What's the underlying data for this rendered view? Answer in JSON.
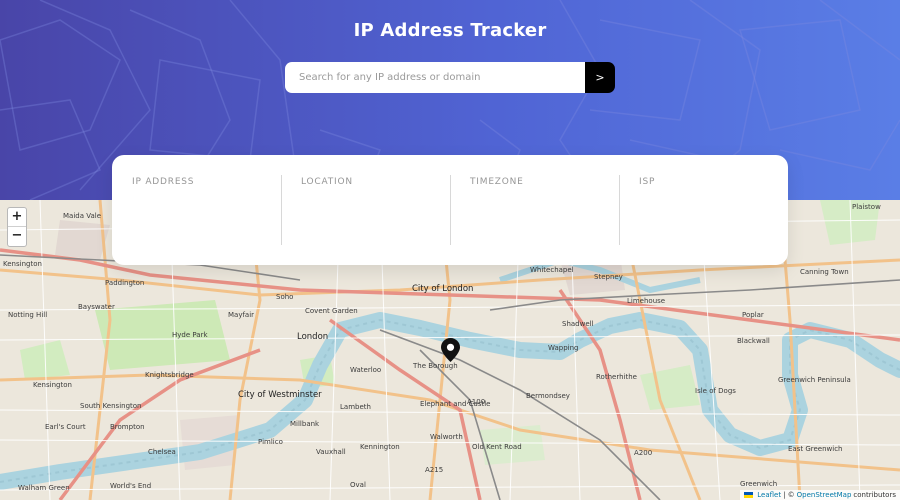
{
  "app": {
    "title": "IP Address Tracker"
  },
  "search": {
    "placeholder": "Search for any IP address or domain",
    "value": "",
    "submit_label": ">"
  },
  "info": [
    {
      "label": "IP ADDRESS",
      "value": ""
    },
    {
      "label": "LOCATION",
      "value": ""
    },
    {
      "label": "TIMEZONE",
      "value": ""
    },
    {
      "label": "ISP",
      "value": ""
    }
  ],
  "map": {
    "zoom_in": "+",
    "zoom_out": "−",
    "attribution": {
      "leaflet": "Leaflet",
      "separator": "| ©",
      "osm": "OpenStreetMap",
      "suffix": "contributors"
    },
    "labels": {
      "maida_vale": "Maida Vale",
      "kensington_top": "Kensington",
      "paddington": "Paddington",
      "bayswater": "Bayswater",
      "notting_hill": "Notting Hill",
      "kensington": "Kensington",
      "south_kensington": "South Kensington",
      "earls_court": "Earl's Court",
      "brompton": "Brompton",
      "chelsea": "Chelsea",
      "walham_green": "Walham Green",
      "worlds_end": "World's End",
      "hyde_park": "Hyde Park",
      "knightsbridge": "Knightsbridge",
      "mayfair": "Mayfair",
      "soho": "Soho",
      "covent_garden": "Covent Garden",
      "london": "London",
      "city_of_westminster": "City of Westminster",
      "pimlico": "Pimlico",
      "millbank": "Millbank",
      "vauxhall": "Vauxhall",
      "lambeth": "Lambeth",
      "waterloo": "Waterloo",
      "the_borough": "The Borough",
      "elephant_and_castle": "Elephant and Castle",
      "kennington": "Kennington",
      "walworth": "Walworth",
      "oval": "Oval",
      "old_kent_road": "Old Kent Road",
      "city_of_london": "City of London",
      "whitechapel": "Whitechapel",
      "stepney": "Stepney",
      "limehouse": "Limehouse",
      "shadwell": "Shadwell",
      "wapping": "Wapping",
      "rotherhithe": "Rotherhithe",
      "bermondsey": "Bermondsey",
      "isle_of_dogs": "Isle of Dogs",
      "poplar": "Poplar",
      "blackwall": "Blackwall",
      "canning_town": "Canning Town",
      "plaistow": "Plaistow",
      "greenwich_peninsula": "Greenwich Peninsula",
      "greenwich": "Greenwich",
      "east_greenwich": "East Greenwich",
      "a100": "A100",
      "a200": "A200",
      "a215": "A215"
    }
  }
}
